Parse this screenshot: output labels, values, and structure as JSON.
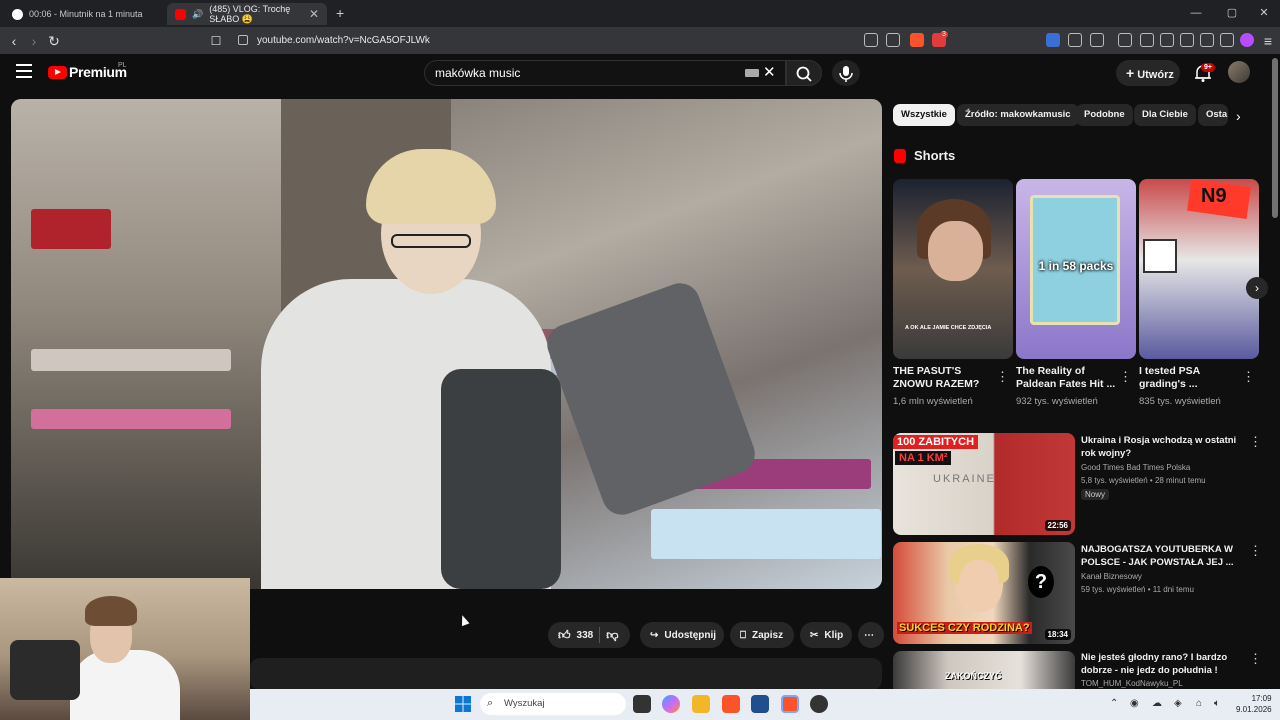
{
  "browser": {
    "tabs": [
      {
        "label": "00:06 - Minutnik na 1 minuta",
        "close": "✕"
      },
      {
        "label": "(485) VLOG: Trochę SŁABO 😩",
        "close": "✕"
      }
    ],
    "new_tab": "+",
    "url": "youtube.com/watch?v=NcGA5OFJLWk",
    "ext_badge": "3"
  },
  "youtube": {
    "logo_text": "Premium",
    "logo_region": "PL",
    "search_value": "makówka music",
    "create_label": "Utwórz",
    "notif_badge": "9+"
  },
  "actions": {
    "likes": "338",
    "share": "Udostępnij",
    "save": "Zapisz",
    "clip": "Klip",
    "more": "⋯"
  },
  "chips": [
    "Wszystkie",
    "Źródło: makowkamusic",
    "Podobne",
    "Dla Ciebie",
    "Osta"
  ],
  "shorts": {
    "heading": "Shorts",
    "items": [
      {
        "title": "THE PASUT'S ZNOWU RAZEM?",
        "views": "1,6 mln wyświetleń",
        "overlay": "A OK ALE JAMIE CHCE ZDJĘCIA"
      },
      {
        "title": "The Reality of Paldean Fates Hit ...",
        "views": "932 tys. wyświetleń",
        "overlay": "1 in 58 packs"
      },
      {
        "title": "I tested PSA grading's ...",
        "views": "835 tys. wyświetleń",
        "overlay": "N9"
      }
    ]
  },
  "related": [
    {
      "title": "Ukraina i Rosja wchodzą w ostatni rok wojny?",
      "channel": "Good Times Bad Times Polska",
      "meta": "5,8 tys. wyświetleń • 28 minut temu",
      "badge": "Nowy",
      "duration": "22:56",
      "thumb_text_1": "100 ZABITYCH",
      "thumb_text_2": "NA 1 KM²",
      "thumb_text_3": "UKRAINE"
    },
    {
      "title": "NAJBOGATSZA YOUTUBERKA W POLSCE - JAK POWSTAŁA JEJ ...",
      "channel": "Kanał Biznesowy",
      "meta": "59 tys. wyświetleń • 11 dni temu",
      "duration": "18:34",
      "thumb_text_1": "SUKCES CZY RODZINA?",
      "thumb_text_2": "?"
    },
    {
      "title": "Nie jesteś głodny rano? I bardzo dobrze - nie jedz do południa !",
      "channel": "TOM_HUM_KodNawyku_PL",
      "thumb_text_1": "ZAKOŃCZYĆ"
    }
  ],
  "taskbar": {
    "search_placeholder": "Wyszukaj",
    "time": "17:09",
    "date": "9.01.2026"
  },
  "colors": {
    "yt_red": "#ff0000",
    "bg": "#0f0f0f",
    "chip": "#272727"
  }
}
